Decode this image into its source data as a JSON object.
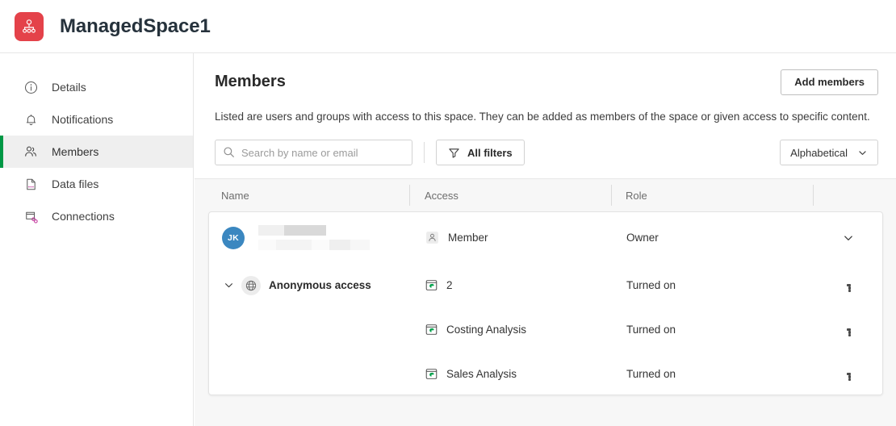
{
  "header": {
    "space_name": "ManagedSpace1",
    "logo_icon": "space-hierarchy-icon",
    "logo_color": "#e4424a"
  },
  "sidebar": {
    "items": [
      {
        "label": "Details",
        "icon": "info-circle-icon",
        "selected": false
      },
      {
        "label": "Notifications",
        "icon": "bell-icon",
        "selected": false
      },
      {
        "label": "Members",
        "icon": "people-icon",
        "selected": true
      },
      {
        "label": "Data files",
        "icon": "data-file-icon",
        "selected": false
      },
      {
        "label": "Connections",
        "icon": "connections-icon",
        "selected": false
      }
    ],
    "selected_accent": "#009845"
  },
  "main": {
    "title": "Members",
    "description": "Listed are users and groups with access to this space. They can be added as members of the space or given access to specific content.",
    "add_members_label": "Add members",
    "search": {
      "placeholder": "Search by name or email",
      "value": "",
      "icon": "search-icon"
    },
    "filters_label": "All filters",
    "filters_icon": "filter-funnel-icon",
    "sort_label": "Alphabetical",
    "sort_icon": "chevron-down-icon"
  },
  "table": {
    "columns": [
      "Name",
      "Access",
      "Role",
      ""
    ],
    "rows": [
      {
        "type": "user",
        "avatar_initials": "JK",
        "avatar_color": "#3b87c0",
        "name": "",
        "email": "",
        "redacted": true,
        "access_icon": "member-person-icon",
        "access": "Member",
        "role": "Owner",
        "action_icon": "chevron-down-icon"
      },
      {
        "type": "group",
        "expander_icon": "chevron-down-icon",
        "group_icon": "globe-icon",
        "name": "Anonymous access",
        "access_icon": "app-icon",
        "access": "2",
        "role": "Turned on",
        "action_icon": "more-options-icon"
      },
      {
        "type": "child",
        "access_icon": "app-icon",
        "access": "Costing Analysis",
        "role": "Turned on",
        "action_icon": "more-options-icon"
      },
      {
        "type": "child",
        "access_icon": "app-icon",
        "access": "Sales Analysis",
        "role": "Turned on",
        "action_icon": "more-options-icon"
      }
    ]
  }
}
